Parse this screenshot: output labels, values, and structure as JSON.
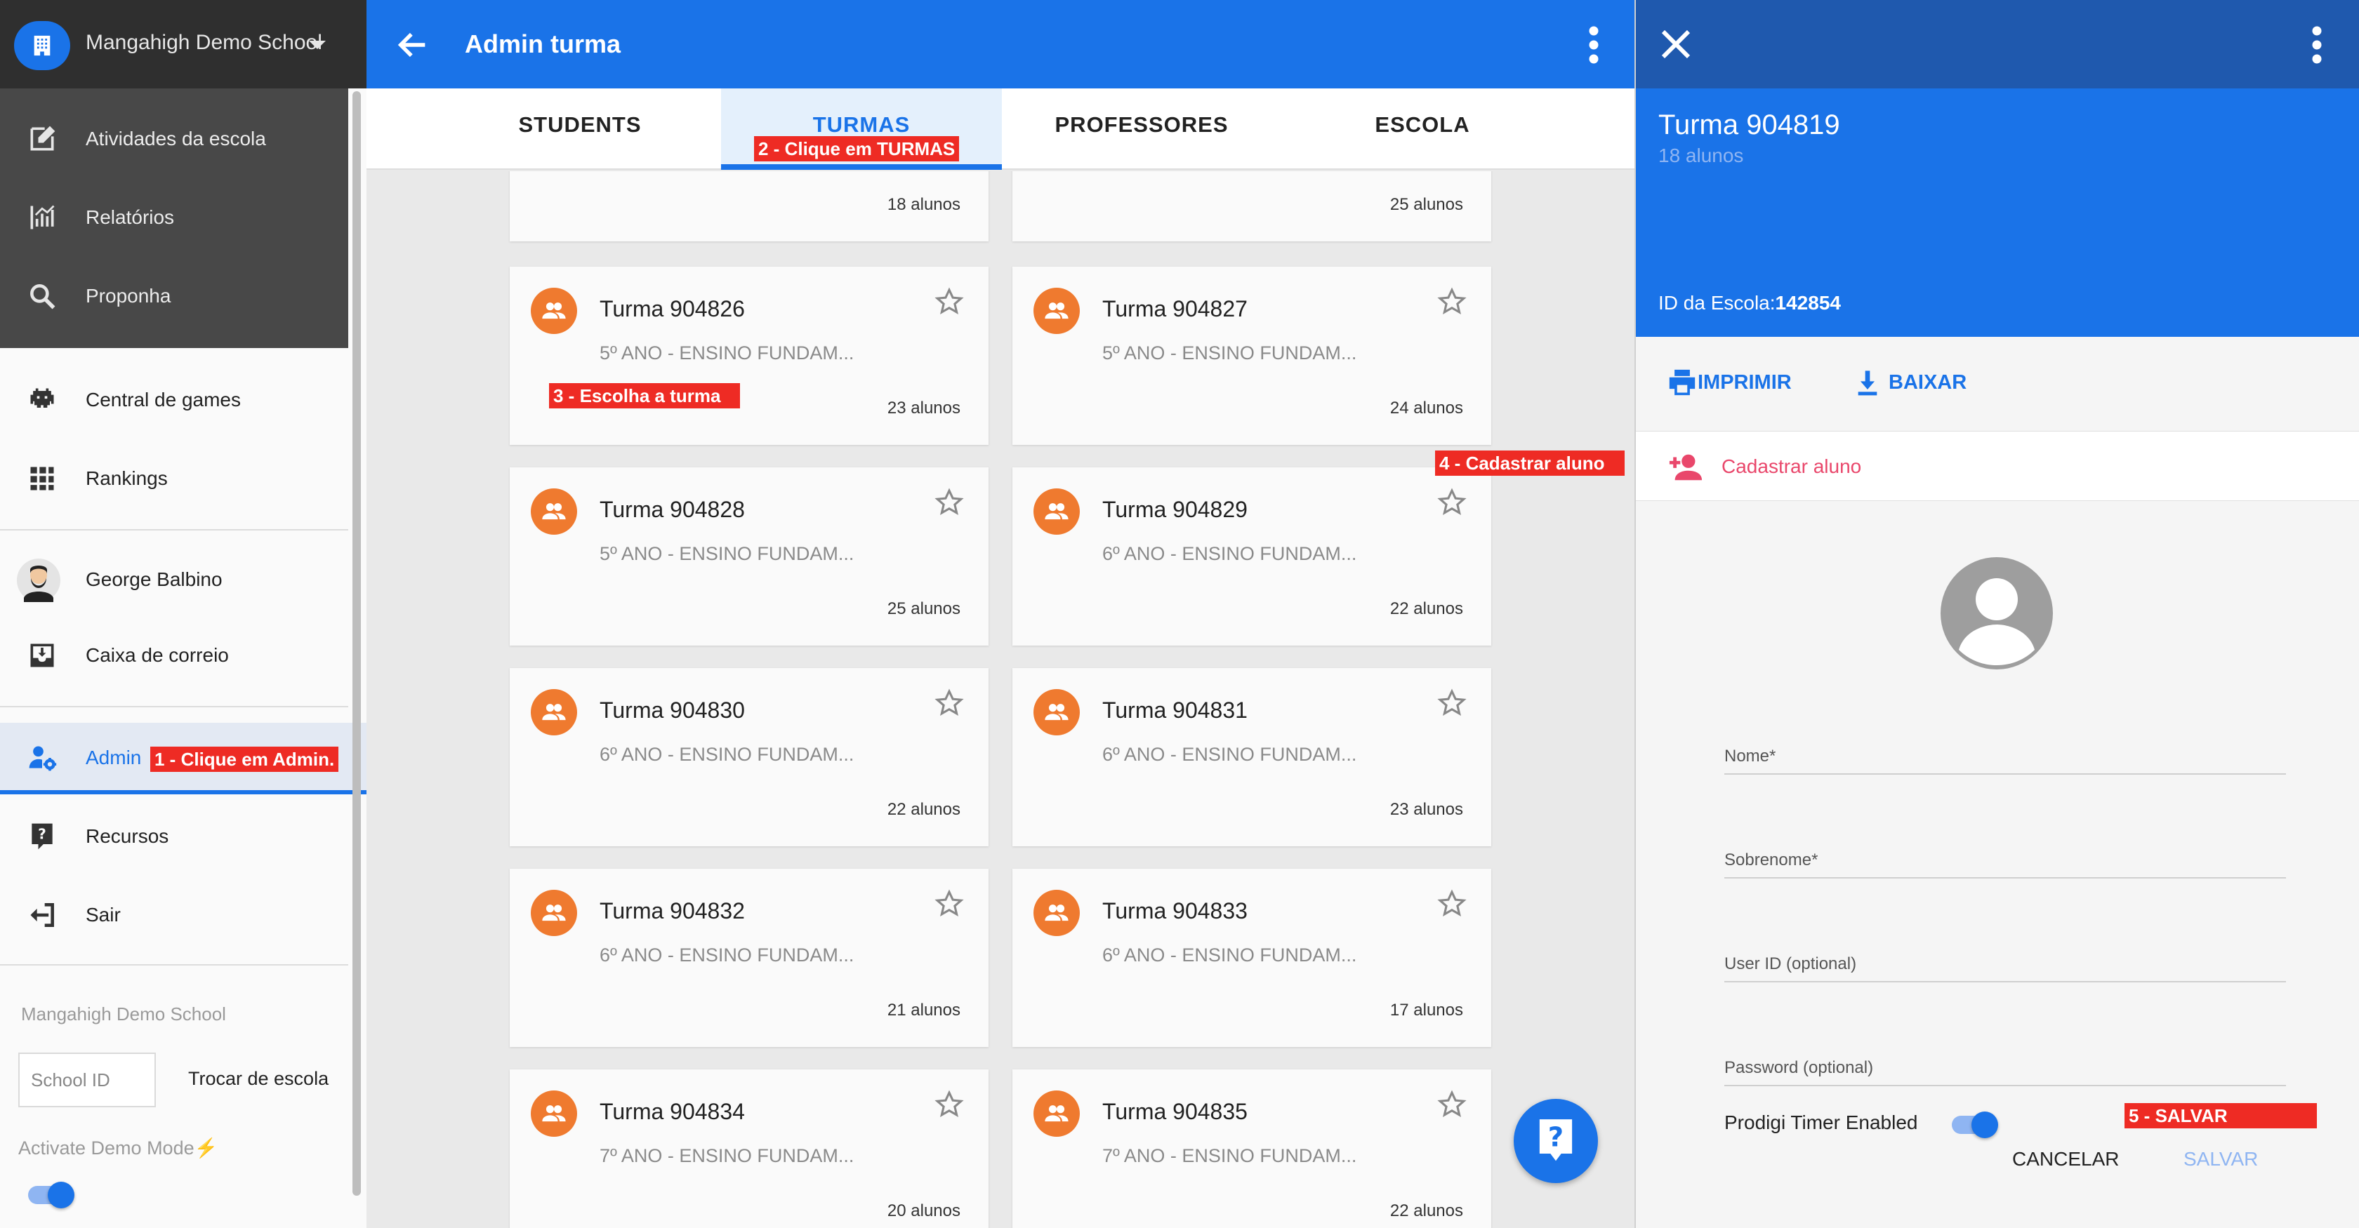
{
  "sidebar": {
    "school_name": "Mangahigh Demo School",
    "items": [
      {
        "label": "Atividades da escola"
      },
      {
        "label": "Relatórios"
      },
      {
        "label": "Proponha"
      },
      {
        "label": "Central de games"
      },
      {
        "label": "Rankings"
      },
      {
        "label": "George Balbino"
      },
      {
        "label": "Caixa de correio"
      },
      {
        "label": "Admin"
      },
      {
        "label": "Recursos"
      },
      {
        "label": "Sair"
      }
    ],
    "footer_school": "Mangahigh Demo School",
    "school_id_placeholder": "School ID",
    "switch_school_label": "Trocar de escola",
    "demo_mode_label": "Activate Demo Mode⚡"
  },
  "appbar": {
    "title": "Admin turma"
  },
  "tabs": [
    {
      "label": "STUDENTS"
    },
    {
      "label": "TURMAS"
    },
    {
      "label": "PROFESSORES"
    },
    {
      "label": "ESCOLA"
    }
  ],
  "partial_cards": [
    {
      "count": "18 alunos"
    },
    {
      "count": "25 alunos"
    }
  ],
  "classes": [
    {
      "name": "Turma 904826",
      "grade": "5º ANO - ENSINO FUNDAM...",
      "count": "23 alunos"
    },
    {
      "name": "Turma 904827",
      "grade": "5º ANO - ENSINO FUNDAM...",
      "count": "24 alunos"
    },
    {
      "name": "Turma 904828",
      "grade": "5º ANO - ENSINO FUNDAM...",
      "count": "25 alunos"
    },
    {
      "name": "Turma 904829",
      "grade": "6º ANO - ENSINO FUNDAM...",
      "count": "22 alunos"
    },
    {
      "name": "Turma 904830",
      "grade": "6º ANO - ENSINO FUNDAM...",
      "count": "22 alunos"
    },
    {
      "name": "Turma 904831",
      "grade": "6º ANO - ENSINO FUNDAM...",
      "count": "23 alunos"
    },
    {
      "name": "Turma 904832",
      "grade": "6º ANO - ENSINO FUNDAM...",
      "count": "21 alunos"
    },
    {
      "name": "Turma 904833",
      "grade": "6º ANO - ENSINO FUNDAM...",
      "count": "17 alunos"
    },
    {
      "name": "Turma 904834",
      "grade": "7º ANO - ENSINO FUNDAM...",
      "count": "20 alunos"
    },
    {
      "name": "Turma 904835",
      "grade": "7º ANO - ENSINO FUNDAM...",
      "count": "22 alunos"
    }
  ],
  "panel": {
    "title": "Turma 904819",
    "subtitle": "18 alunos",
    "school_id_label": "ID da Escola:",
    "school_id": "142854",
    "print_label": "IMPRIMIR",
    "download_label": "BAIXAR",
    "add_student_label": "Cadastrar aluno",
    "fields": {
      "first_name": "Nome*",
      "last_name": "Sobrenome*",
      "user_id": "User ID (optional)",
      "password": "Password (optional)"
    },
    "timer_label": "Prodigi Timer Enabled",
    "cancel_label": "CANCELAR",
    "save_label": "SALVAR"
  },
  "annotations": {
    "step1": "1 - Clique em Admin.",
    "step2": "2 - Clique em TURMAS",
    "step3": "3 - Escolha a turma",
    "step4": "4 - Cadastrar aluno",
    "step5": "5 - SALVAR"
  },
  "colors": {
    "primary": "#1a73e8",
    "panel_top": "#1f59ae",
    "class_avatar": "#ef7a2f",
    "accent_pink": "#e9476b",
    "annotation": "#ee2b24"
  }
}
